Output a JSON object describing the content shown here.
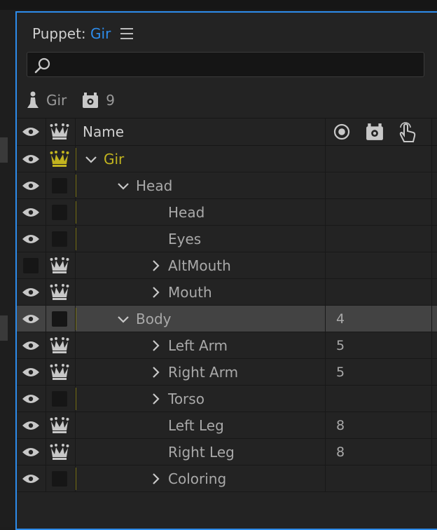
{
  "panel": {
    "title_prefix": "Puppet:",
    "title_name": "Gir"
  },
  "search": {
    "placeholder": "",
    "value": ""
  },
  "info": {
    "puppet_name": "Gir",
    "behavior_count": "9"
  },
  "header": {
    "name_label": "Name"
  },
  "colors": {
    "accent": "#2d8ceb",
    "root_gold": "#c2b41f",
    "track_mark": "#7a7418",
    "selected_row": "#434343"
  },
  "rows": [
    {
      "label": "Gir",
      "level": 0,
      "expander": "open",
      "visible": true,
      "crown": "gold",
      "mark": true,
      "count": ""
    },
    {
      "label": "Head",
      "level": 1,
      "expander": "open",
      "visible": true,
      "crown": "box",
      "mark": true,
      "count": ""
    },
    {
      "label": "Head",
      "level": 2,
      "expander": "none",
      "visible": true,
      "crown": "box",
      "mark": true,
      "count": ""
    },
    {
      "label": "Eyes",
      "level": 2,
      "expander": "none",
      "visible": true,
      "crown": "box",
      "mark": true,
      "count": ""
    },
    {
      "label": "AltMouth",
      "level": 2,
      "expander": "closed",
      "visible": false,
      "crown": "crown",
      "mark": false,
      "count": ""
    },
    {
      "label": "Mouth",
      "level": 2,
      "expander": "closed",
      "visible": true,
      "crown": "crown",
      "mark": false,
      "count": ""
    },
    {
      "label": "Body",
      "level": 1,
      "expander": "open",
      "visible": true,
      "crown": "box",
      "mark": true,
      "count": "4",
      "selected": true
    },
    {
      "label": "Left Arm",
      "level": 2,
      "expander": "closed",
      "visible": true,
      "crown": "crown",
      "mark": false,
      "count": "5"
    },
    {
      "label": "Right Arm",
      "level": 2,
      "expander": "closed",
      "visible": true,
      "crown": "crown",
      "mark": false,
      "count": "5"
    },
    {
      "label": "Torso",
      "level": 2,
      "expander": "closed",
      "visible": true,
      "crown": "box",
      "mark": true,
      "count": ""
    },
    {
      "label": "Left Leg",
      "level": 2,
      "expander": "none",
      "visible": true,
      "crown": "crown",
      "mark": false,
      "count": "8"
    },
    {
      "label": "Right Leg",
      "level": 2,
      "expander": "none",
      "visible": true,
      "crown": "crown",
      "mark": false,
      "count": "8"
    },
    {
      "label": "Coloring",
      "level": 2,
      "expander": "closed",
      "visible": true,
      "crown": "box",
      "mark": true,
      "count": ""
    }
  ]
}
